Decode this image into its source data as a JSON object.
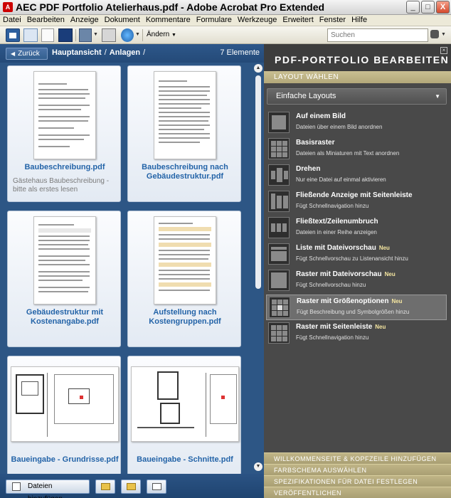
{
  "window": {
    "title": "AEC PDF Portfolio Atelierhaus.pdf - Adobe Acrobat Pro Extended",
    "app_icon_glyph": "A",
    "minimize_glyph": "_",
    "maximize_glyph": "□",
    "close_glyph": "X"
  },
  "menu": [
    "Datei",
    "Bearbeiten",
    "Anzeige",
    "Dokument",
    "Kommentare",
    "Formulare",
    "Werkzeuge",
    "Erweitert",
    "Fenster",
    "Hilfe"
  ],
  "toolbar": {
    "andern_label": "Ändern",
    "dropdown_glyph": "▼",
    "search_placeholder": "Suchen"
  },
  "nav": {
    "back_label": "Zurück",
    "back_arrow": "◀",
    "crumb_root": "Hauptansicht",
    "crumb_sep": "/",
    "crumb_child": "Anlagen",
    "crumb_trail": "/",
    "count": "7 Elemente"
  },
  "files": [
    {
      "name": "Baubeschreibung.pdf",
      "desc": "Gästehaus Baubeschreibung - bitte als erstes lesen"
    },
    {
      "name": "Baubeschreibung nach Gebäudestruktur.pdf",
      "desc": ""
    },
    {
      "name": "Gebäudestruktur mit Kostenangabe.pdf",
      "desc": ""
    },
    {
      "name": "Aufstellung nach Kostengruppen.pdf",
      "desc": ""
    },
    {
      "name": "Baueingabe - Grundrisse.pdf",
      "desc": ""
    },
    {
      "name": "Baueingabe - Schnitte.pdf",
      "desc": ""
    }
  ],
  "scroll": {
    "up": "▲",
    "down": "▼"
  },
  "bottom": {
    "add_files_label": "Dateien hinzufügen"
  },
  "panel": {
    "title": "PDF-PORTFOLIO BEARBEITEN",
    "close_glyph": "×",
    "layout_section": "LAYOUT WÄHLEN",
    "layout_dropdown": "Einfache Layouts",
    "layouts": [
      {
        "name": "Auf einem Bild",
        "neu": "",
        "desc": "Dateien über einem Bild anordnen"
      },
      {
        "name": "Basisraster",
        "neu": "",
        "desc": "Dateien als Miniaturen mit Text anordnen"
      },
      {
        "name": "Drehen",
        "neu": "",
        "desc": "Nur eine Datei auf einmal aktivieren"
      },
      {
        "name": "Fließende Anzeige mit Seitenleiste",
        "neu": "",
        "desc": "Fügt Schnellnavigation hinzu"
      },
      {
        "name": "Fließtext/Zeilenumbruch",
        "neu": "",
        "desc": "Dateien in einer Reihe anzeigen"
      },
      {
        "name": "Liste mit Dateivorschau",
        "neu": "Neu",
        "desc": "Fügt Schnellvorschau zu Listenansicht hinzu"
      },
      {
        "name": "Raster mit Dateivorschau",
        "neu": "Neu",
        "desc": "Fügt Schnellvorschau hinzu"
      },
      {
        "name": "Raster mit Größenoptionen",
        "neu": "Neu",
        "desc": "Fügt Beschreibung und Symbolgrößen hinzu"
      },
      {
        "name": "Raster mit Seitenleiste",
        "neu": "Neu",
        "desc": "Fügt Schnellnavigation hinzu"
      }
    ],
    "footer": [
      "WILLKOMMENSEITE & KOPFZEILE HINZUFÜGEN",
      "FARBSCHEMA AUSWÄHLEN",
      "SPEZIFIKATIONEN FÜR DATEI FESTLEGEN",
      "VERÖFFENTLICHEN"
    ]
  }
}
